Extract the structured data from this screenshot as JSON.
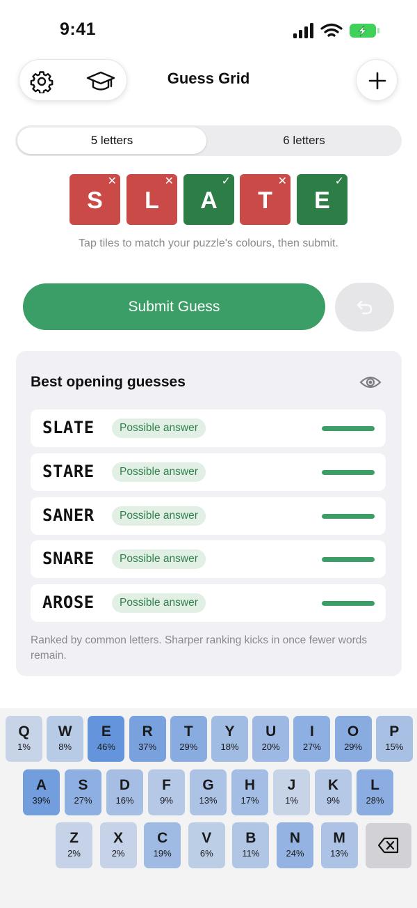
{
  "status_bar": {
    "time": "9:41"
  },
  "header": {
    "title": "Guess Grid"
  },
  "segments": {
    "five": "5 letters",
    "six": "6 letters",
    "selected": "five"
  },
  "guess_tiles": [
    {
      "letter": "S",
      "state": "absent",
      "mark": "✕"
    },
    {
      "letter": "L",
      "state": "absent",
      "mark": "✕"
    },
    {
      "letter": "A",
      "state": "correct",
      "mark": "✓"
    },
    {
      "letter": "T",
      "state": "absent",
      "mark": "✕"
    },
    {
      "letter": "E",
      "state": "correct",
      "mark": "✓"
    }
  ],
  "hint": "Tap tiles to match your puzzle's colours, then submit.",
  "submit_label": "Submit Guess",
  "suggestions": {
    "title": "Best opening guesses",
    "items": [
      {
        "word": "SLATE",
        "badge": "Possible answer",
        "score": 1.0
      },
      {
        "word": "STARE",
        "badge": "Possible answer",
        "score": 1.0
      },
      {
        "word": "SANER",
        "badge": "Possible answer",
        "score": 1.0
      },
      {
        "word": "SNARE",
        "badge": "Possible answer",
        "score": 1.0
      },
      {
        "word": "AROSE",
        "badge": "Possible answer",
        "score": 1.0
      }
    ],
    "note": "Ranked by common letters. Sharper ranking kicks in once fewer words remain."
  },
  "keyboard": {
    "rows": [
      [
        {
          "k": "Q",
          "p": "1%"
        },
        {
          "k": "W",
          "p": "8%"
        },
        {
          "k": "E",
          "p": "46%"
        },
        {
          "k": "R",
          "p": "37%"
        },
        {
          "k": "T",
          "p": "29%"
        },
        {
          "k": "Y",
          "p": "18%"
        },
        {
          "k": "U",
          "p": "20%"
        },
        {
          "k": "I",
          "p": "27%"
        },
        {
          "k": "O",
          "p": "29%"
        },
        {
          "k": "P",
          "p": "15%"
        }
      ],
      [
        {
          "k": "A",
          "p": "39%"
        },
        {
          "k": "S",
          "p": "27%"
        },
        {
          "k": "D",
          "p": "16%"
        },
        {
          "k": "F",
          "p": "9%"
        },
        {
          "k": "G",
          "p": "13%"
        },
        {
          "k": "H",
          "p": "17%"
        },
        {
          "k": "J",
          "p": "1%"
        },
        {
          "k": "K",
          "p": "9%"
        },
        {
          "k": "L",
          "p": "28%"
        }
      ],
      [
        {
          "k": "Z",
          "p": "2%"
        },
        {
          "k": "X",
          "p": "2%"
        },
        {
          "k": "C",
          "p": "19%"
        },
        {
          "k": "V",
          "p": "6%"
        },
        {
          "k": "B",
          "p": "11%"
        },
        {
          "k": "N",
          "p": "24%"
        },
        {
          "k": "M",
          "p": "13%"
        }
      ]
    ]
  },
  "colors": {
    "absent": "#c94a46",
    "correct": "#2d7d47",
    "accent": "#3a9e66"
  }
}
